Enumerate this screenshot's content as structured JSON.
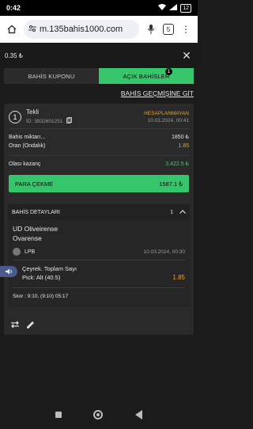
{
  "status": {
    "time": "0:42",
    "battery": "12"
  },
  "browser": {
    "url": "m.135bahis1000.com",
    "tab_count": "5"
  },
  "header": {
    "balance": "0.35 ₺"
  },
  "tabs": [
    {
      "label": "BAHİS KUPONU",
      "active": false
    },
    {
      "label": "AÇIK BAHİSLER",
      "active": true,
      "badge": "1"
    }
  ],
  "history_link": "BAHİS GEÇMİŞİNE GİT",
  "bet": {
    "type_number": "1",
    "type_label": "Tekli",
    "id_label": "ID:",
    "id": "3932601251",
    "status": "HESAPLANMAYAN",
    "datetime": "10.03.2024, 00:41",
    "amount_label": "Bahis miktarı...",
    "amount_value": "1850 ₺",
    "odds_label": "Oran (Ondalık)",
    "odds_value": "1.85",
    "potential_label": "Olası kazanç",
    "potential_value": "3,422.5 ₺",
    "cashout_label": "PARA ÇEKME",
    "cashout_amount": "1587.1 ₺"
  },
  "details": {
    "header": "BAHİS DETAYLARI",
    "count": "1",
    "team_home": "UD Oliveirense",
    "team_away": "Ovarense",
    "league": "LPB",
    "event_time": "10.03.2024, 00:30",
    "market": "Çeyrek. Toplam Sayı",
    "pick": "Pick: Alt (40.5)",
    "pick_odds": "1.85",
    "score": "Skor : 9:10, (9:10) 05:17"
  },
  "colors": {
    "accent": "#35c56b",
    "status": "#e0a43c",
    "background": "#1b1b1b"
  }
}
